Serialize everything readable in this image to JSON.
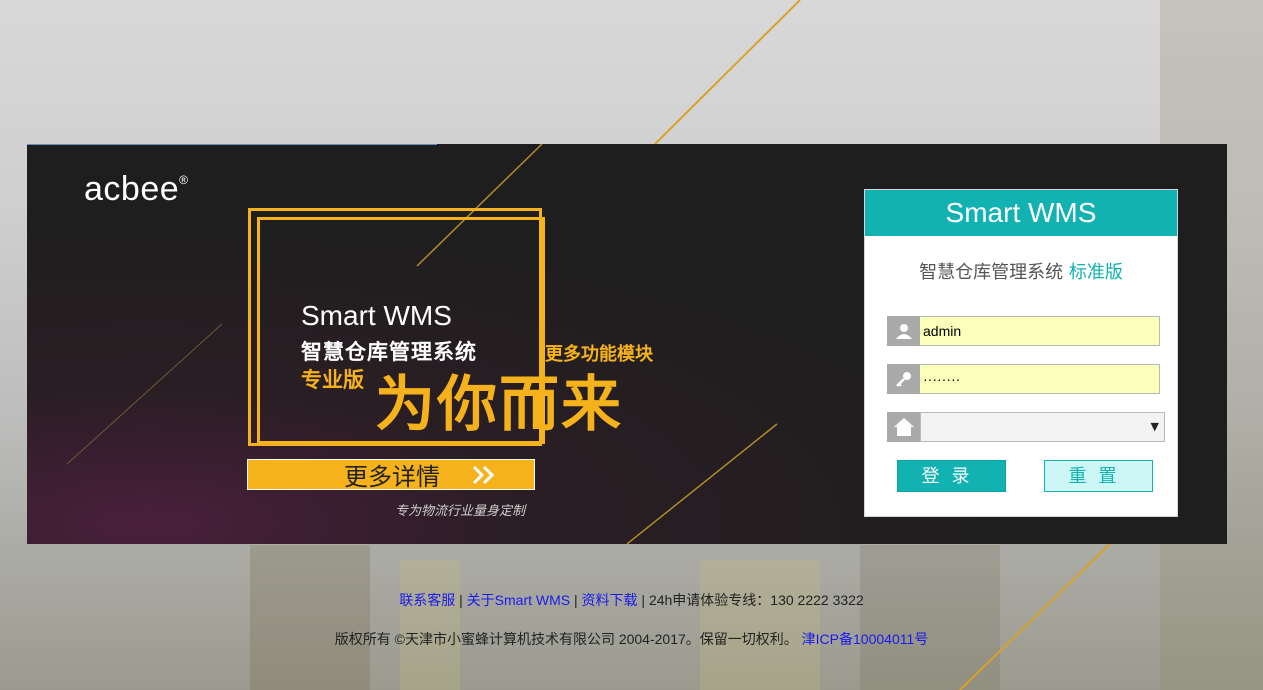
{
  "brand": {
    "logo": "acbee",
    "registered": "®"
  },
  "promo": {
    "title_en": "Smart WMS",
    "title_cn": "智慧仓库管理系统",
    "edition": "专业版",
    "more_modules": "更多功能模块",
    "slogan": "为你而来",
    "details_button": "更多详情",
    "tagline": "专为物流行业量身定制",
    "accent_color": "#f6b21b"
  },
  "login": {
    "header": "Smart WMS",
    "subtitle": "智慧仓库管理系统",
    "subtitle_edition": "标准版",
    "username_value": "admin",
    "password_value": "········",
    "warehouse_selected": "",
    "login_button": "登录",
    "reset_button": "重置",
    "accent_color": "#12b2b2",
    "icons": [
      "user-icon",
      "key-icon",
      "home-icon"
    ]
  },
  "footer": {
    "links": [
      "联系客服",
      "关于Smart WMS",
      "资料下载"
    ],
    "separator": "|",
    "hotline": "24h申请体验专线：130 2222 3322",
    "copyright": "版权所有 ©天津市小蜜蜂计算机技术有限公司 2004-2017。保留一切权利。",
    "icp": "津ICP备10004011号"
  }
}
